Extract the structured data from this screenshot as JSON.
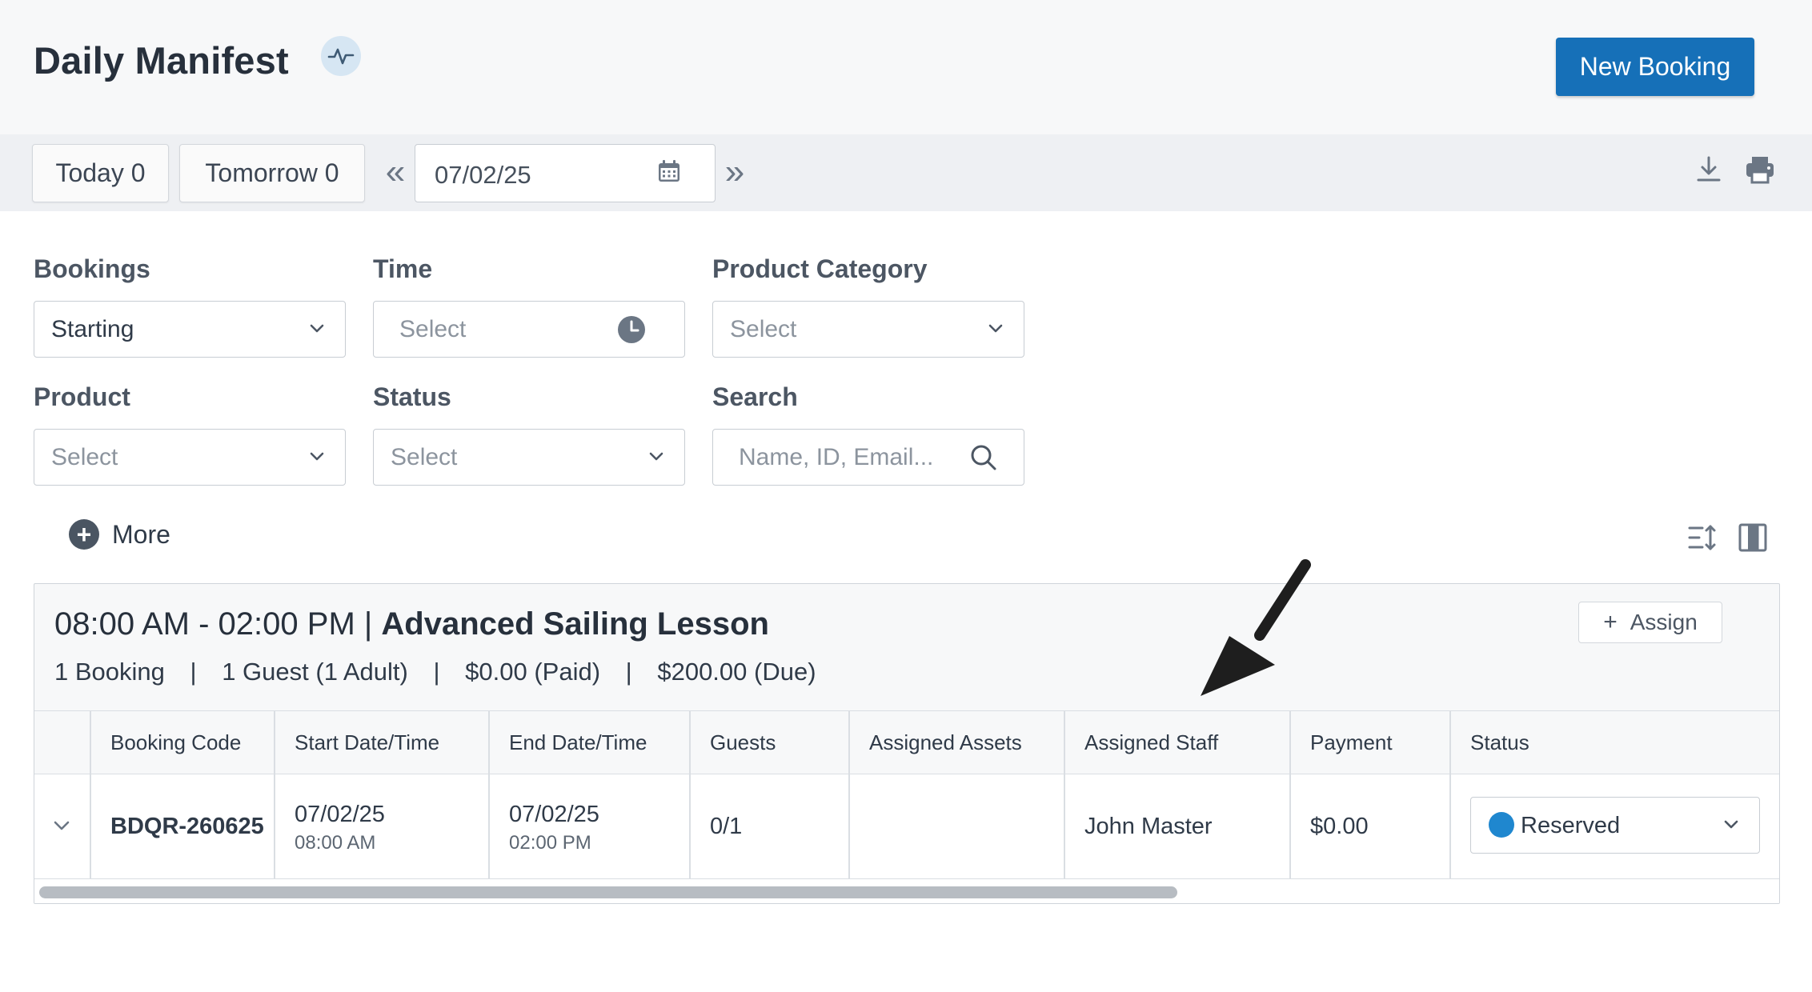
{
  "header": {
    "title": "Daily Manifest",
    "new_booking_label": "New Booking"
  },
  "toolbar": {
    "today_label": "Today 0",
    "tomorrow_label": "Tomorrow 0",
    "prev_label": "«",
    "next_label": "»",
    "date_value": "07/02/25"
  },
  "filters": {
    "bookings": {
      "label": "Bookings",
      "value": "Starting"
    },
    "time": {
      "label": "Time",
      "placeholder": "Select"
    },
    "product_category": {
      "label": "Product Category",
      "placeholder": "Select"
    },
    "product": {
      "label": "Product",
      "placeholder": "Select"
    },
    "status": {
      "label": "Status",
      "placeholder": "Select"
    },
    "search": {
      "label": "Search",
      "placeholder": "Name, ID, Email..."
    },
    "more_label": "More"
  },
  "group": {
    "time_range": "08:00 AM - 02:00 PM |",
    "product_name": "Advanced Sailing Lesson",
    "summary": {
      "bookings": "1 Booking",
      "guests": "1 Guest (1 Adult)",
      "paid": "$0.00 (Paid)",
      "due": "$200.00 (Due)",
      "separator": "|"
    },
    "assign_label": "Assign",
    "assign_plus": "+"
  },
  "table": {
    "columns": [
      "Booking Code",
      "Start Date/Time",
      "End Date/Time",
      "Guests",
      "Assigned Assets",
      "Assigned Staff",
      "Payment",
      "Status"
    ],
    "rows": [
      {
        "booking_code": "BDQR-260625",
        "start_date": "07/02/25",
        "start_time": "08:00 AM",
        "end_date": "07/02/25",
        "end_time": "02:00 PM",
        "guests": "0/1",
        "assigned_assets": "",
        "assigned_staff": "John Master",
        "payment": "$0.00",
        "status": "Reserved",
        "status_color": "#1f87cf"
      }
    ]
  },
  "icons": {
    "header_badge": "activity-pulse-icon",
    "date_picker": "calendar-icon",
    "time_picker": "clock-icon",
    "search": "search-icon",
    "download": "download-icon",
    "print": "printer-icon",
    "sort": "sort-icon",
    "columns": "columns-icon",
    "annotation": "arrow-pointer-icon"
  },
  "colors": {
    "primary": "#1670b8",
    "status_reserved": "#1f87cf"
  }
}
